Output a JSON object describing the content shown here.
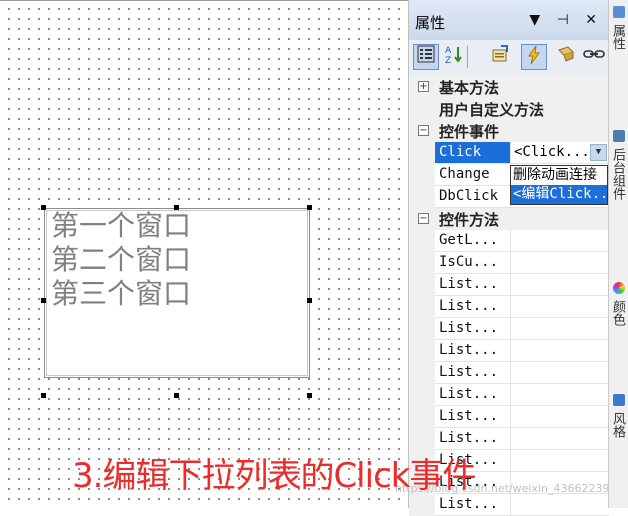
{
  "listbox": {
    "items": [
      "第一个窗口",
      "第二个窗口",
      "第三个窗口"
    ]
  },
  "panel": {
    "title": "属性",
    "window_controls": "▼ ⊣ ✕",
    "toolbar": {
      "categorized_icon": "categorized-view-icon",
      "sort_icon": "sort-az-icon",
      "properties_icon": "properties-icon",
      "events_icon": "lightning-events-icon",
      "methods_icon": "methods-icon",
      "link_icon": "link-icon"
    },
    "categories": [
      {
        "toggle": "+",
        "label": "基本方法"
      },
      {
        "toggle": "",
        "label": "用户自定义方法"
      },
      {
        "toggle": "−",
        "label": "控件事件"
      },
      {
        "toggle": "−",
        "label": "控件方法"
      }
    ],
    "events": [
      {
        "name": "Click",
        "value": "<Click..."
      },
      {
        "name": "Change",
        "value": ""
      },
      {
        "name": "DbClick",
        "value": ""
      }
    ],
    "methods": [
      "GetL...",
      "IsCu...",
      "List...",
      "List...",
      "List...",
      "List...",
      "List...",
      "List...",
      "List...",
      "List...",
      "List...",
      "List...",
      "List..."
    ],
    "dropdown": [
      "删除动画连接",
      "<编辑Click..."
    ]
  },
  "side_tabs": [
    "属性",
    "后台组件",
    "颜色",
    "风格"
  ],
  "caption": "3.编辑下拉列表的Click事件",
  "watermark": "https://blog.csdn.net/weixin_43662239",
  "colors": {
    "accent": "#1c6ed8",
    "caption": "#ee2b2b"
  }
}
